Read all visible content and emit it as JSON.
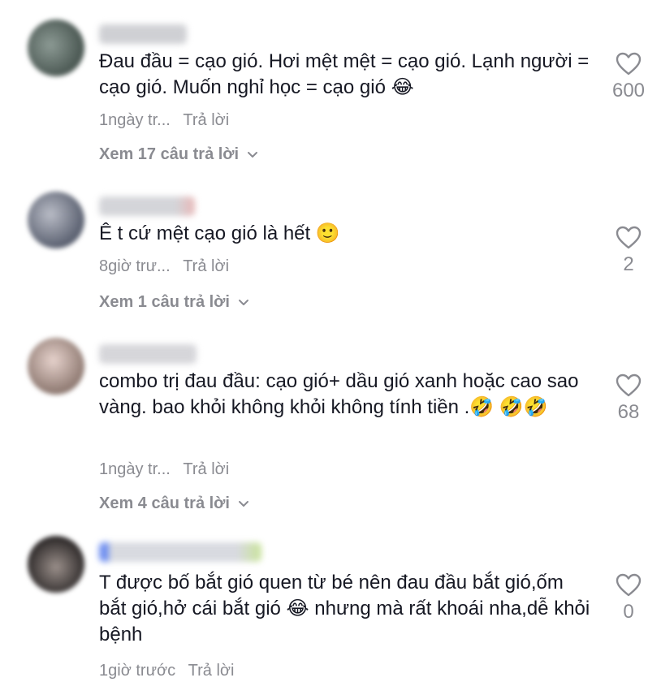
{
  "comments": [
    {
      "text": "Đau đầu = cạo gió. Hơi mệt mệt = cạo gió. Lạnh người = cạo gió. Muốn nghỉ học = cạo gió 😂",
      "time": "1ngày tr...",
      "reply_label": "Trả lời",
      "likes": "600",
      "view_replies": "Xem 17 câu trả lời"
    },
    {
      "text": "Ê t cứ mệt cạo gió là hết 🙂",
      "time": "8giờ trư...",
      "reply_label": "Trả lời",
      "likes": "2",
      "view_replies": "Xem 1 câu trả lời"
    },
    {
      "text": "combo trị đau đầu: cạo gió+ dầu gió xanh hoặc cao sao vàng. bao khỏi không khỏi không tính tiền .🤣 🤣🤣",
      "time": "1ngày tr...",
      "reply_label": "Trả lời",
      "likes": "68",
      "view_replies": "Xem 4 câu trả lời"
    },
    {
      "text": "T được bố bắt gió quen từ bé nên đau đầu bắt gió,ốm bắt gió,hở cái bắt gió 😂 nhưng mà rất khoái nha,dễ khỏi bệnh",
      "time": "1giờ trước",
      "reply_label": "Trả lời",
      "likes": "0"
    }
  ],
  "icons": {
    "like": "heart-outline-icon",
    "expand": "chevron-down-icon"
  },
  "colors": {
    "text": "#161823",
    "muted": "#8a8b91"
  }
}
